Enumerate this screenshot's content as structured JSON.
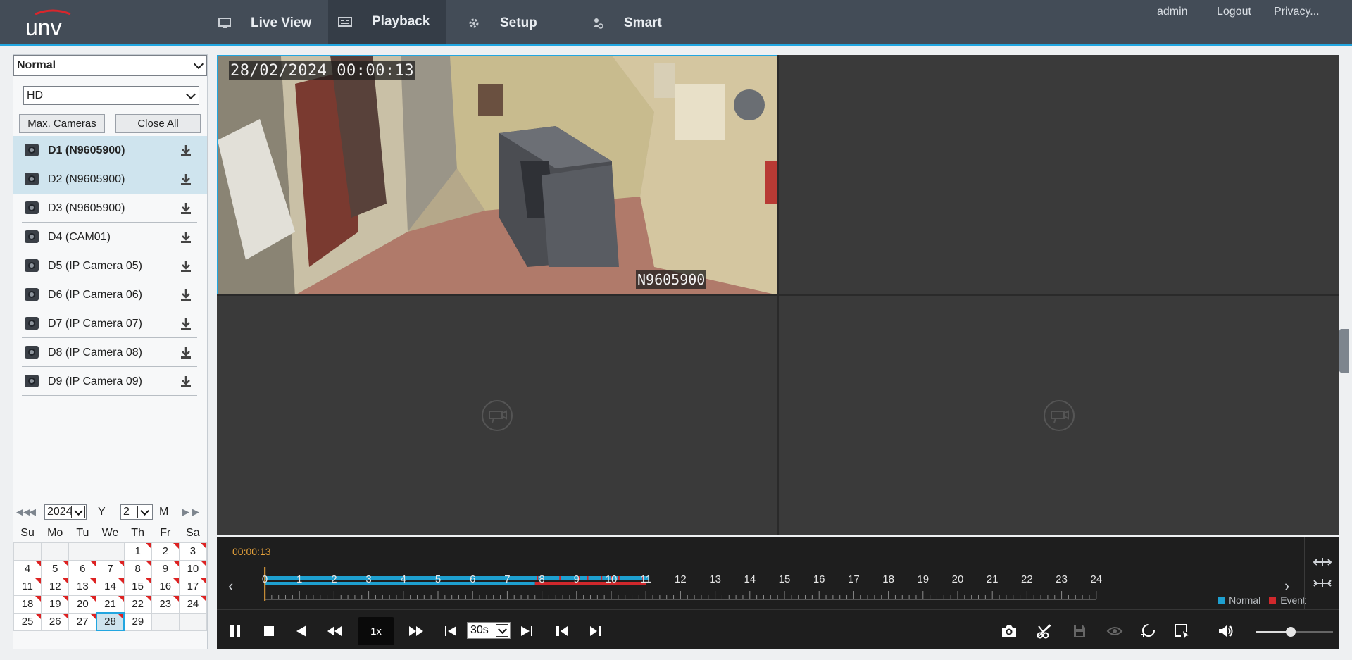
{
  "header": {
    "logo_text": "UNV",
    "nav": [
      {
        "label": "Live View",
        "icon": "monitor-icon"
      },
      {
        "label": "Playback",
        "icon": "playback-icon",
        "active": true
      },
      {
        "label": "Setup",
        "icon": "gear-icon"
      },
      {
        "label": "Smart",
        "icon": "smart-person-icon"
      }
    ],
    "user": "admin",
    "logout": "Logout",
    "privacy": "Privacy...",
    "accent_color": "#22a6e0"
  },
  "sidebar": {
    "mode_value": "Normal",
    "stream_value": "HD",
    "max_cameras_label": "Max. Cameras",
    "close_all_label": "Close All",
    "cameras": [
      {
        "label": "D1 (N9605900)",
        "selected": true
      },
      {
        "label": "D2 (N9605900)",
        "selected": true
      },
      {
        "label": "D3 (N9605900)",
        "selected": false
      },
      {
        "label": "D4 (CAM01)",
        "selected": false
      },
      {
        "label": "D5 (IP Camera 05)",
        "selected": false
      },
      {
        "label": "D6 (IP Camera 06)",
        "selected": false
      },
      {
        "label": "D7 (IP Camera 07)",
        "selected": false
      },
      {
        "label": "D8 (IP Camera 08)",
        "selected": false
      },
      {
        "label": "D9 (IP Camera 09)",
        "selected": false
      }
    ]
  },
  "calendar": {
    "year": "2024",
    "year_suffix": "Y",
    "month": "2",
    "month_suffix": "M",
    "weekdays": [
      "Su",
      "Mo",
      "Tu",
      "We",
      "Th",
      "Fr",
      "Sa"
    ],
    "weeks": [
      [
        "",
        "",
        "",
        "",
        "1",
        "2",
        "3"
      ],
      [
        "4",
        "5",
        "6",
        "7",
        "8",
        "9",
        "10"
      ],
      [
        "11",
        "12",
        "13",
        "14",
        "15",
        "16",
        "17"
      ],
      [
        "18",
        "19",
        "20",
        "21",
        "22",
        "23",
        "24"
      ],
      [
        "25",
        "26",
        "27",
        "28",
        "29",
        "",
        ""
      ]
    ],
    "marked_days": [
      "1",
      "2",
      "3",
      "4",
      "5",
      "6",
      "7",
      "8",
      "9",
      "10",
      "11",
      "12",
      "13",
      "14",
      "15",
      "16",
      "17",
      "18",
      "19",
      "20",
      "21",
      "22",
      "23",
      "24",
      "25",
      "26",
      "27",
      "28"
    ],
    "selected_day": "28"
  },
  "video": {
    "osd_timestamp": "28/02/2024 00:00:13",
    "osd_camera_name": "N9605900"
  },
  "timeline": {
    "current_time": "00:00:13",
    "hours": [
      "0",
      "1",
      "2",
      "3",
      "4",
      "5",
      "6",
      "7",
      "8",
      "9",
      "10",
      "11",
      "12",
      "13",
      "14",
      "15",
      "16",
      "17",
      "18",
      "19",
      "20",
      "21",
      "22",
      "23",
      "24"
    ],
    "legend": {
      "normal": "Normal",
      "event": "Event"
    },
    "normal_color": "#1ea0d0",
    "event_color": "#d0282c",
    "speed": "1x",
    "interval": "30s",
    "volume": 0.45
  }
}
